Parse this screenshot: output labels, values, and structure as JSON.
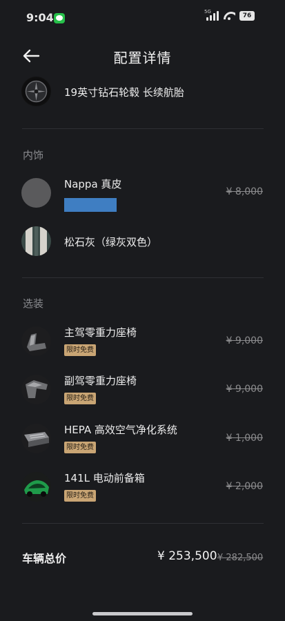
{
  "status_bar": {
    "time": "9:04",
    "network": "5G",
    "battery": "76"
  },
  "header": {
    "title": "配置详情"
  },
  "wheel": {
    "title": "19英寸钻石轮毂 长续航胎"
  },
  "interior": {
    "section_label": "内饰",
    "items": [
      {
        "title": "Nappa 真皮",
        "price": "¥ 8,000",
        "swatch_color": "#5a5a5c"
      },
      {
        "title": "松石灰（绿灰双色）",
        "swatch_color": "#c8c6bf"
      }
    ]
  },
  "options": {
    "section_label": "选装",
    "items": [
      {
        "title": "主驾零重力座椅",
        "badge": "限时免费",
        "price": "¥ 9,000"
      },
      {
        "title": "副驾零重力座椅",
        "badge": "限时免费",
        "price": "¥ 9,000"
      },
      {
        "title": "HEPA 高效空气净化系统",
        "badge": "限时免费",
        "price": "¥ 1,000"
      },
      {
        "title": "141L 电动前备箱",
        "badge": "限时免费",
        "price": "¥ 2,000"
      }
    ]
  },
  "total": {
    "label": "车辆总价",
    "price": "¥ 253,500",
    "original_price": "¥ 282,500"
  },
  "colors": {
    "background": "#1a1b1e",
    "badge": "#c9a574",
    "accent_green": "#1f9a4a"
  }
}
